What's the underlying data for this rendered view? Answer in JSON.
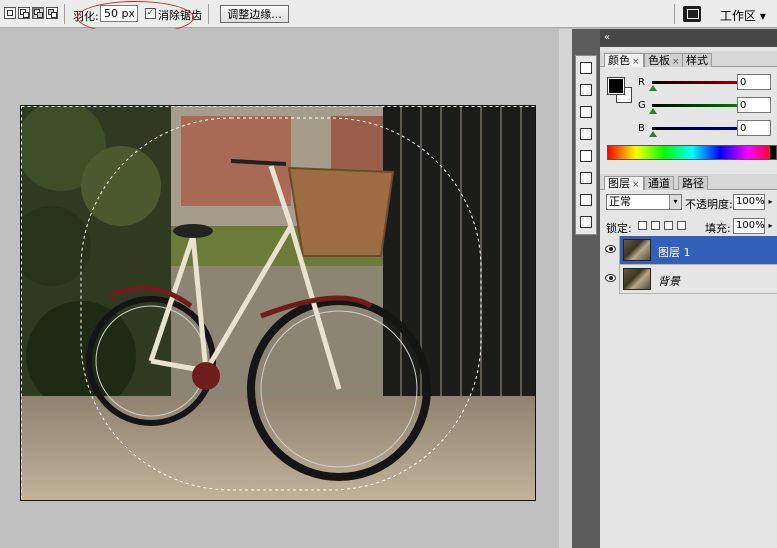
{
  "toolbar": {
    "feather_label": "羽化:",
    "feather_value": "50 px",
    "antialias_label": "消除锯齿",
    "antialias_checked": "✓",
    "refine_edge_label": "调整边缘...",
    "workspace_label": "工作区 ▾"
  },
  "color_panel": {
    "tabs": [
      {
        "label": "颜色",
        "close": "×"
      },
      {
        "label": "色板",
        "close": "×"
      },
      {
        "label": "样式",
        "close": ""
      }
    ],
    "sliders": [
      {
        "channel": "R",
        "value": "0",
        "color": "#cc0000"
      },
      {
        "channel": "G",
        "value": "0",
        "color": "#00aa00"
      },
      {
        "channel": "B",
        "value": "0",
        "color": "#0000cc"
      }
    ]
  },
  "layers_panel": {
    "tabs": [
      {
        "label": "图层",
        "close": "×"
      },
      {
        "label": "通道",
        "close": ""
      },
      {
        "label": "路径",
        "close": ""
      }
    ],
    "blend_mode": "正常",
    "opacity_label": "不透明度:",
    "opacity_value": "100%",
    "lock_label": "锁定:",
    "fill_label": "填充:",
    "fill_value": "100%",
    "layers": [
      {
        "name": "图层 1",
        "selected": true
      },
      {
        "name": "背景",
        "selected": false
      }
    ]
  },
  "icons": {
    "workspace": "workspace-icon",
    "collapse": "«",
    "dropdown": "▾"
  }
}
